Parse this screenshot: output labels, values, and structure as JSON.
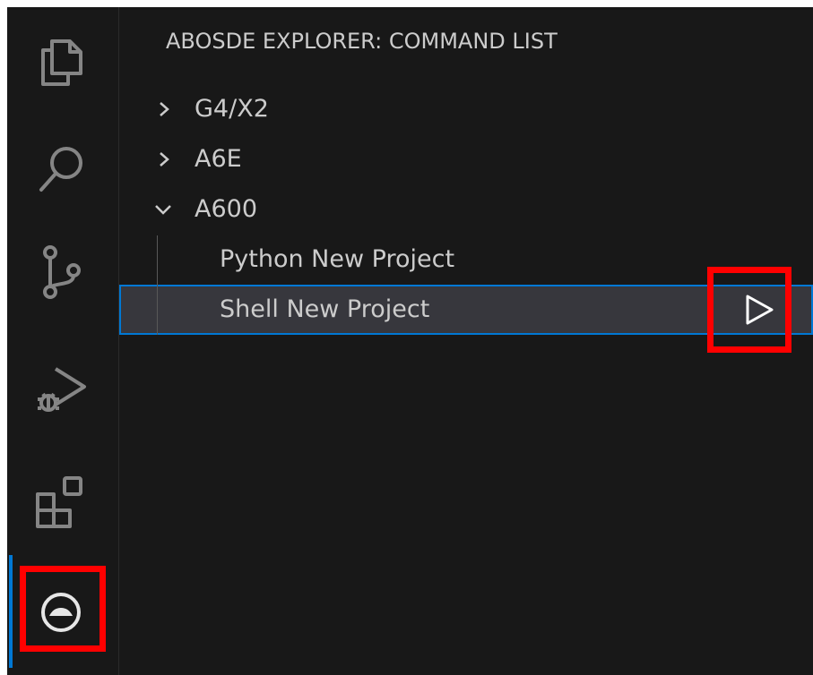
{
  "sidebar": {
    "title": "ABOSDE EXPLORER: COMMAND LIST",
    "tree": [
      {
        "label": "G4/X2",
        "expanded": false
      },
      {
        "label": "A6E",
        "expanded": false
      },
      {
        "label": "A600",
        "expanded": true
      }
    ],
    "children": [
      {
        "label": "Python New Project"
      },
      {
        "label": "Shell New Project",
        "selected": true
      }
    ]
  },
  "activity_bar": {
    "icons": [
      "explorer-icon",
      "search-icon",
      "source-control-icon",
      "run-debug-icon",
      "extensions-icon",
      "abosde-icon"
    ]
  },
  "colors": {
    "background": "#181818",
    "text": "#cccccc",
    "accent": "#0078d4",
    "selection": "#37373d",
    "annotation": "#ff0000"
  }
}
